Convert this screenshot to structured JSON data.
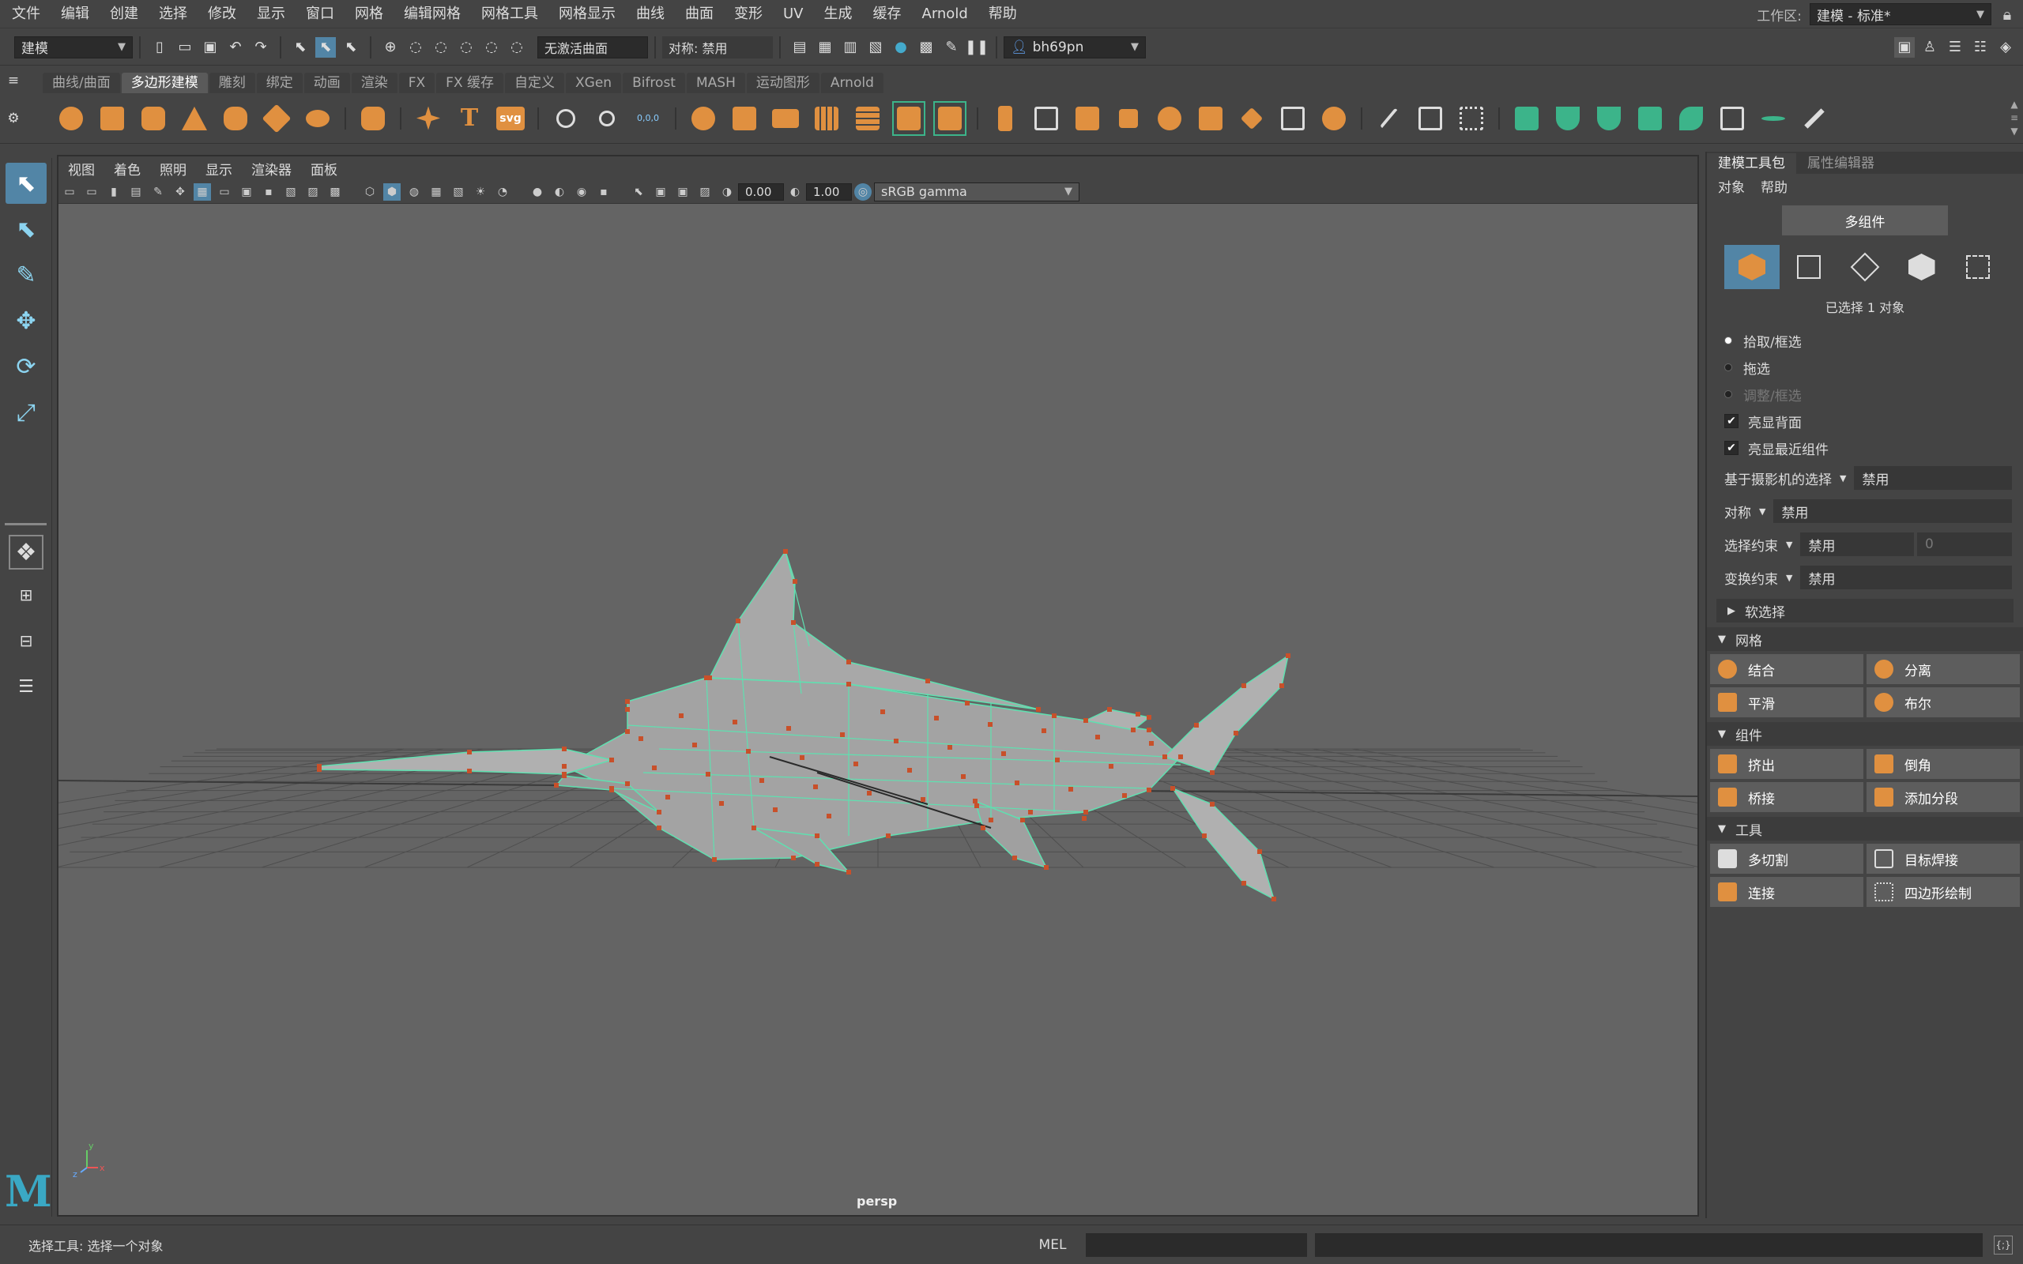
{
  "menubar": {
    "items": [
      "文件",
      "编辑",
      "创建",
      "选择",
      "修改",
      "显示",
      "窗口",
      "网格",
      "编辑网格",
      "网格工具",
      "网格显示",
      "曲线",
      "曲面",
      "变形",
      "UV",
      "生成",
      "缓存",
      "Arnold",
      "帮助"
    ],
    "workspace_label": "工作区:",
    "workspace_value": "建模 - 标准*"
  },
  "statusline": {
    "mode": "建模",
    "live_surface": "无激活曲面",
    "symmetry": "对称: 禁用",
    "user": "bh69pn"
  },
  "shelf_tabs": [
    "曲线/曲面",
    "多边形建模",
    "雕刻",
    "绑定",
    "动画",
    "渲染",
    "FX",
    "FX 缓存",
    "自定义",
    "XGen",
    "Bifrost",
    "MASH",
    "运动图形",
    "Arnold"
  ],
  "shelf_active": "多边形建模",
  "shelf_text_icons": {
    "text_tool": "T",
    "svg_tool": "svg",
    "reset": "0,0,0"
  },
  "viewport": {
    "menu": [
      "视图",
      "着色",
      "照明",
      "显示",
      "渲染器",
      "面板"
    ],
    "exposure": "0.00",
    "gamma": "1.00",
    "colorspace": "sRGB gamma",
    "camera": "persp",
    "axis_x": "x",
    "axis_y": "y",
    "axis_z": "z"
  },
  "panel": {
    "tabs": [
      "建模工具包",
      "属性编辑器"
    ],
    "menu": [
      "对象",
      "帮助"
    ],
    "multi_component": "多组件",
    "selected": "已选择 1 对象",
    "radio": [
      {
        "label": "拾取/框选",
        "on": true,
        "disabled": false
      },
      {
        "label": "拖选",
        "on": false,
        "disabled": false
      },
      {
        "label": "调整/框选",
        "on": false,
        "disabled": true
      }
    ],
    "checks": [
      {
        "label": "亮显背面",
        "checked": true
      },
      {
        "label": "亮显最近组件",
        "checked": true
      }
    ],
    "camera_sel_label": "基于摄影机的选择",
    "camera_sel_value": "禁用",
    "symmetry_label": "对称",
    "symmetry_value": "禁用",
    "sel_constraint_label": "选择约束",
    "sel_constraint_value": "禁用",
    "sel_constraint_num": "0",
    "xform_constraint_label": "变换约束",
    "xform_constraint_value": "禁用",
    "soft_select": "软选择",
    "sections": {
      "mesh": {
        "title": "网格",
        "buttons": [
          "结合",
          "分离",
          "平滑",
          "布尔"
        ]
      },
      "component": {
        "title": "组件",
        "buttons": [
          "挤出",
          "倒角",
          "桥接",
          "添加分段"
        ]
      },
      "tools": {
        "title": "工具",
        "buttons": [
          "多切割",
          "目标焊接",
          "连接",
          "四边形绘制"
        ]
      }
    }
  },
  "bottom": {
    "help": "选择工具: 选择一个对象",
    "mel": "MEL"
  },
  "colors": {
    "accent": "#5285a6",
    "shelf_orange": "#e09040",
    "wire_teal": "#5fe0b0",
    "vertex": "#c8502a"
  }
}
